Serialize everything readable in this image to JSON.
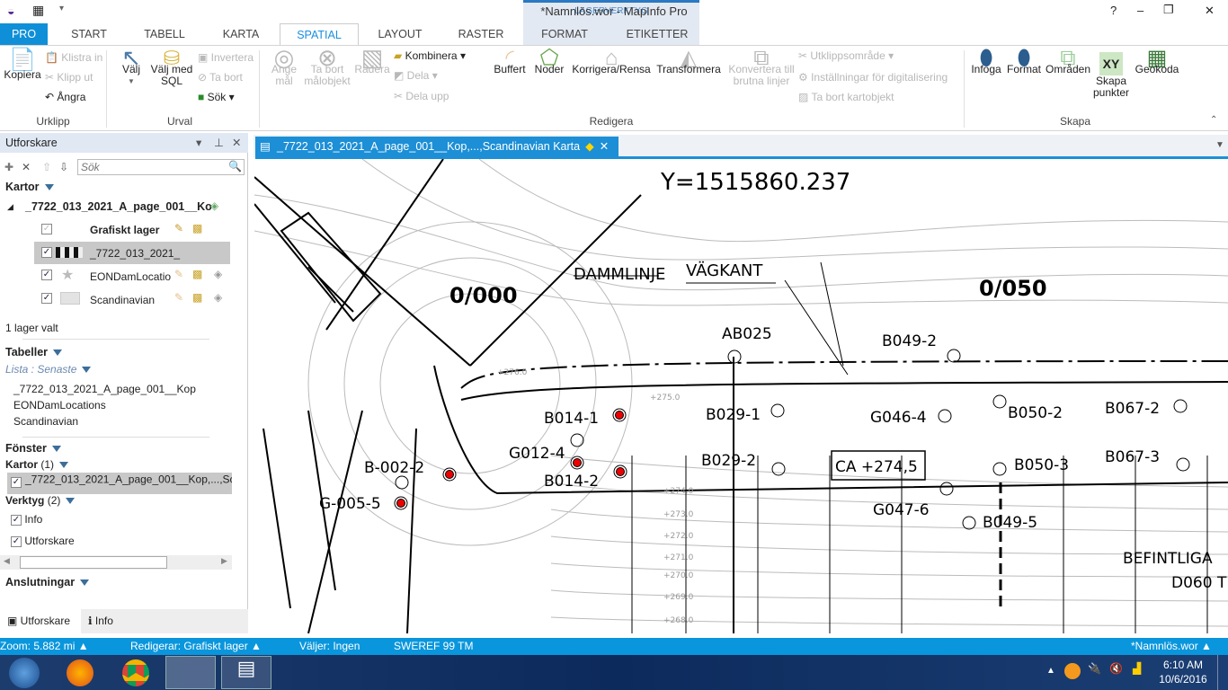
{
  "window": {
    "title": "*Namnlös.wor - MapInfo Pro",
    "context_group": "LAGERVERKTYG",
    "controls": [
      "?",
      "–",
      "❐",
      "✕"
    ]
  },
  "tabs": [
    "PRO",
    "START",
    "TABELL",
    "KARTA",
    "SPATIAL",
    "LAYOUT",
    "RASTER",
    "FORMAT",
    "ETIKETTER"
  ],
  "active_tab": "SPATIAL",
  "ribbon": {
    "urklipp": {
      "label": "Urklipp",
      "kopiera": "Kopiera",
      "klistra": "Klistra in",
      "klipp": "Klipp ut",
      "angra": "Ångra"
    },
    "urval": {
      "label": "Urval",
      "valj": "Välj",
      "valj_sql": "Välj med SQL",
      "invertera": "Invertera",
      "ta_bort": "Ta bort",
      "sok": "Sök"
    },
    "redigera": {
      "label": "Redigera",
      "ange": "Ange mål",
      "ta_bort_mal": "Ta bort målobjekt",
      "radera": "Radera",
      "kombinera": "Kombinera",
      "dela": "Dela",
      "dela_upp": "Dela upp",
      "buffert": "Buffert",
      "noder": "Noder",
      "korrigera": "Korrigera/Rensa",
      "transformera": "Transformera",
      "konvertera": "Konvertera till brutna linjer",
      "utklipp": "Utklippsområde",
      "installningar": "Inställningar för digitalisering",
      "ta_bort_kartobj": "Ta bort kartobjekt"
    },
    "skapa": {
      "label": "Skapa",
      "infoga": "Infoga",
      "format": "Format",
      "omraden": "Områden",
      "skapa_punkter": "Skapa punkter",
      "geokoda": "Geokoda"
    }
  },
  "explorer": {
    "title": "Utforskare",
    "search_placeholder": "Sök",
    "maps_header": "Kartor",
    "map_name": "_7722_013_2021_A_page_001__Ko",
    "layers": [
      {
        "name": "Grafiskt lager",
        "checked": true
      },
      {
        "name": "_7722_013_2021_",
        "checked": true
      },
      {
        "name": "EONDamLocatio",
        "checked": true
      },
      {
        "name": "Scandinavian",
        "checked": true
      }
    ],
    "selected_count": "1 lager valt",
    "tables_header": "Tabeller",
    "tables_list": "Lista : Senaste",
    "tables": [
      "_7722_013_2021_A_page_001__Kop",
      "EONDamLocations",
      "Scandinavian"
    ],
    "windows_header": "Fönster",
    "maps_count_label": "Kartor",
    "maps_count": "(1)",
    "window_item": "_7722_013_2021_A_page_001__Kop,...,Scan",
    "tools_label": "Verktyg",
    "tools_count": "(2)",
    "tools": [
      "Info",
      "Utforskare"
    ],
    "connections": "Anslutningar",
    "bottom_tabs": [
      "Utforskare",
      "Info"
    ]
  },
  "map": {
    "tab_title": "_7722_013_2021_A_page_001__Kop,...,Scandinavian Karta",
    "labels": {
      "y": "Y=1515860.237",
      "st0": "0/000",
      "st50": "0/050",
      "damm": "DAMMLINJE",
      "vag": "VÄGKANT",
      "ab025": "AB025",
      "b049_2": "B049-2",
      "b014_1": "B014-1",
      "b029_1": "B029-1",
      "g046_4": "G046-4",
      "b050_2": "B050-2",
      "b067_2": "B067-2",
      "g012_4": "G012-4",
      "b014_2": "B014-2",
      "b002_2": "B-002-2",
      "b029_2": "B029-2",
      "ca": "CA +274,5",
      "b050_3": "B050-3",
      "b067_3": "B067-3",
      "g005_5": "G-005-5",
      "g047_6": "G047-6",
      "b049_5": "B049-5",
      "befintliga": "BEFINTLIGA",
      "d060": "D060 T"
    },
    "contours": [
      "+276.0",
      "+275.0",
      "+274.0",
      "+273.0",
      "+272.0",
      "+271.0",
      "+270.0",
      "+269.0",
      "+268.0"
    ]
  },
  "status": {
    "zoom": "Zoom: 5.882 mi",
    "editing": "Redigerar: Grafiskt lager",
    "selecting": "Väljer: Ingen",
    "projection": "SWEREF 99 TM",
    "workspace": "*Namnlös.wor"
  },
  "taskbar": {
    "time": "6:10 AM",
    "date": "10/6/2016"
  }
}
